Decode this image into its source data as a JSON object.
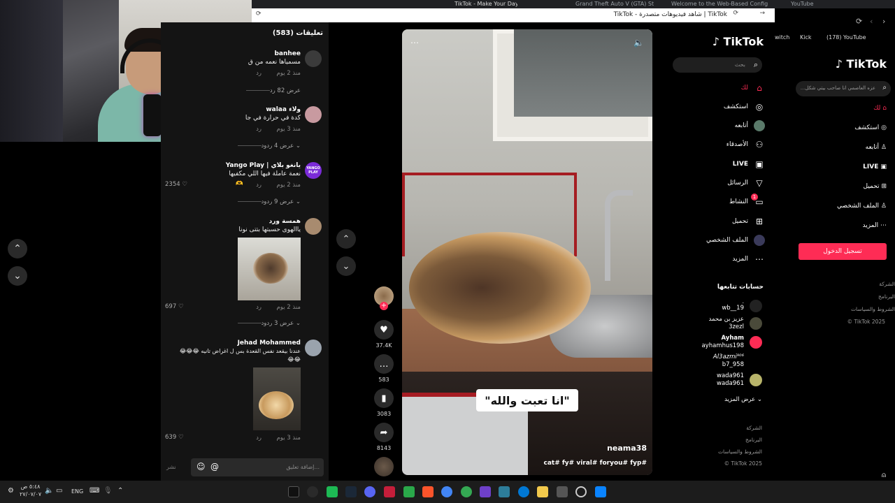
{
  "browser": {
    "tabs": [
      {
        "label": "TikTok - Make Your Day"
      },
      {
        "label": "Grand Theft Auto V (GTA) Streaming"
      },
      {
        "label": "Welcome to the Web-Based Config"
      },
      {
        "label": "YouTube"
      }
    ],
    "url": "TikTok | شاهد فيديوهات متصدرة - TikTok",
    "bookmarks": {
      "twitch": "witch",
      "kick": "Kick",
      "youtube": "(178) YouTube"
    }
  },
  "comments": {
    "header": "تعليقات (583)",
    "items": [
      {
        "user": "banhee",
        "text": "مسمياها نعمه من ق",
        "time": "منذ 2 يوم",
        "reply": "رد",
        "view_replies": "عرض 82 رد",
        "likes": ""
      },
      {
        "user": "walaa ولاء",
        "text": "كدة في حرارة في جا",
        "time": "منذ 3 يوم",
        "reply": "رد",
        "view_replies": "عرض 4 ردود",
        "likes": ""
      },
      {
        "user": "Yango Play | يانغو بلاي",
        "text": "نعمة عاملة فيها اللي مكفيها",
        "time": "منذ 2 يوم",
        "reply": "رد",
        "view_replies": "عرض 9 ردود",
        "likes": "2354",
        "badge": "YANGO PLAY"
      },
      {
        "user": "همسة ورد",
        "text": "ياالهوى حسبتها بتتى نونا",
        "time": "منذ 2 يوم",
        "reply": "رد",
        "view_replies": "عرض 3 ردود",
        "likes": "697"
      },
      {
        "user": "Jehad Mohammed",
        "text": "عندنا بيقعد نفس القعدة بس ل اغراض تانيه 😂😂😂",
        "text2": "😂😂",
        "time": "منذ 3 يوم",
        "reply": "رد",
        "likes": "639"
      }
    ],
    "input_placeholder": "إضافة تعليق...",
    "post_label": "نشر"
  },
  "video": {
    "caption": "\"انا تعبت والله\"",
    "author": "neama38",
    "hashtags": "cat# fy# viral# foryou# fyp#",
    "likes": "37.4K",
    "comments": "583",
    "saves": "3083",
    "shares": "8143"
  },
  "sidebar": {
    "logo": "TikTok",
    "search_placeholder": "بحث",
    "items": [
      {
        "label": "لك",
        "icon": "home-icon"
      },
      {
        "label": "استكشف",
        "icon": "compass-icon"
      },
      {
        "label": "أتابعه",
        "icon": "avatar-icon"
      },
      {
        "label": "الأصدقاء",
        "icon": "friends-icon"
      },
      {
        "label": "LIVE",
        "icon": "live-icon"
      },
      {
        "label": "الرسائل",
        "icon": "send-icon"
      },
      {
        "label": "النشاط",
        "icon": "activity-icon",
        "badge": "1"
      },
      {
        "label": "تحميل",
        "icon": "upload-icon"
      },
      {
        "label": "الملف الشخصي",
        "icon": "profile-icon"
      },
      {
        "label": "المزيد",
        "icon": "more-icon"
      }
    ],
    "following_title": "حسابات تتابعها",
    "following": [
      {
        "name": "wb__19",
        "handle": "."
      },
      {
        "name": "عزيز بن محمد",
        "handle": "3zezl"
      },
      {
        "name": "Ayham",
        "handle": "ayhamhus198"
      },
      {
        "name": "Al3azmi⁹⁰⁶",
        "handle": "b7_958"
      },
      {
        "name": "wada961",
        "handle": "wada961"
      }
    ],
    "see_more": "عرض المزيد",
    "footer": [
      "الشركة",
      "البرنامج",
      "الشروط والسياسات",
      "© TikTok 2025"
    ]
  },
  "right_sidebar": {
    "logo": "TikTok",
    "search_placeholder": "عزه العاصمي انا صاحب بيتي شكل...",
    "items": [
      "لك",
      "استكشف",
      "أتابعه",
      "LIVE",
      "تحميل",
      "الملف الشخصي",
      "المزيد"
    ],
    "login_button": "تسجيل الدخول",
    "footer": [
      "الشركة",
      "البرنامج",
      "الشروط والسياسات",
      "© TikTok 2025"
    ]
  },
  "taskbar": {
    "time": "٥:٤٨ ص",
    "date": "٢٧/٠٧/٠٧",
    "lang": "ENG"
  },
  "colors": {
    "accent": "#fe2c55",
    "bg": "#000000",
    "panel": "#141414"
  }
}
